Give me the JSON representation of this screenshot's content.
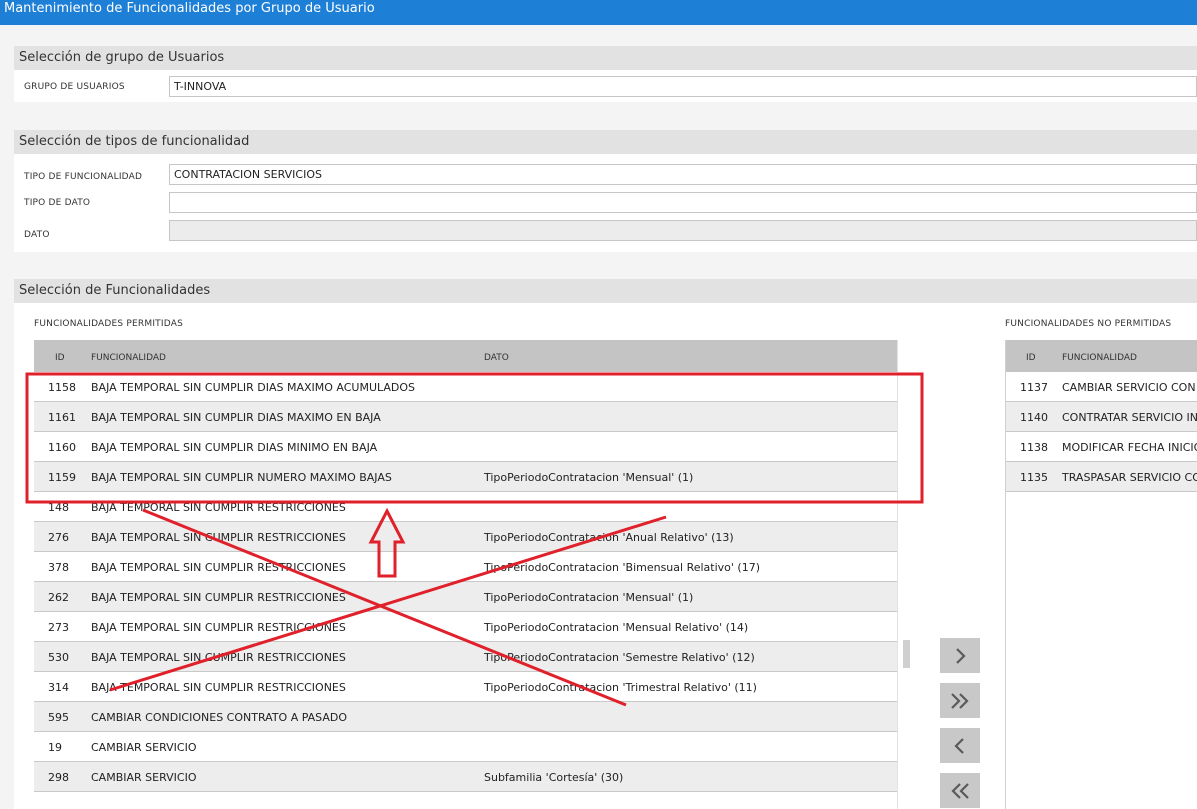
{
  "window": {
    "title": "Mantenimiento de Funcionalidades por Grupo de Usuario"
  },
  "user_group_section": {
    "title": "Selección de grupo de Usuarios",
    "group_label": "GRUPO DE USUARIOS",
    "group_value": "T-INNOVA"
  },
  "type_section": {
    "title": "Selección de tipos de funcionalidad",
    "func_type_label": "TIPO DE FUNCIONALIDAD",
    "func_type_value": "CONTRATACION SERVICIOS",
    "data_type_label": "TIPO DE DATO",
    "data_type_value": "",
    "data_label": "DATO",
    "data_value": ""
  },
  "functions_section": {
    "title": "Selección de Funcionalidades",
    "permitted": {
      "caption": "FUNCIONALIDADES PERMITIDAS",
      "columns": [
        "ID",
        "FUNCIONALIDAD",
        "DATO"
      ],
      "rows": [
        {
          "id": "1158",
          "name": "BAJA TEMPORAL SIN CUMPLIR DIAS MAXIMO ACUMULADOS",
          "dato": ""
        },
        {
          "id": "1161",
          "name": "BAJA TEMPORAL SIN CUMPLIR DIAS MAXIMO EN BAJA",
          "dato": ""
        },
        {
          "id": "1160",
          "name": "BAJA TEMPORAL SIN CUMPLIR DIAS MINIMO EN BAJA",
          "dato": ""
        },
        {
          "id": "1159",
          "name": "BAJA TEMPORAL SIN CUMPLIR NUMERO MAXIMO BAJAS",
          "dato": "TipoPeriodoContratacion 'Mensual' (1)"
        },
        {
          "id": "148",
          "name": "BAJA TEMPORAL SIN CUMPLIR RESTRICCIONES",
          "dato": ""
        },
        {
          "id": "276",
          "name": "BAJA TEMPORAL SIN CUMPLIR RESTRICCIONES",
          "dato": "TipoPeriodoContratacion 'Anual Relativo' (13)"
        },
        {
          "id": "378",
          "name": "BAJA TEMPORAL SIN CUMPLIR RESTRICCIONES",
          "dato": "TipoPeriodoContratacion 'Bimensual Relativo' (17)"
        },
        {
          "id": "262",
          "name": "BAJA TEMPORAL SIN CUMPLIR RESTRICCIONES",
          "dato": "TipoPeriodoContratacion 'Mensual' (1)"
        },
        {
          "id": "273",
          "name": "BAJA TEMPORAL SIN CUMPLIR RESTRICCIONES",
          "dato": "TipoPeriodoContratacion 'Mensual Relativo' (14)"
        },
        {
          "id": "530",
          "name": "BAJA TEMPORAL SIN CUMPLIR RESTRICCIONES",
          "dato": "TipoPeriodoContratacion 'Semestre Relativo' (12)"
        },
        {
          "id": "314",
          "name": "BAJA TEMPORAL SIN CUMPLIR RESTRICCIONES",
          "dato": "TipoPeriodoContratacion 'Trimestral Relativo' (11)"
        },
        {
          "id": "595",
          "name": "CAMBIAR CONDICIONES CONTRATO A PASADO",
          "dato": ""
        },
        {
          "id": "19",
          "name": "CAMBIAR SERVICIO",
          "dato": ""
        },
        {
          "id": "298",
          "name": "CAMBIAR SERVICIO",
          "dato": "Subfamilia 'Cortesía' (30)"
        }
      ]
    },
    "not_permitted": {
      "caption": "FUNCIONALIDADES NO PERMITIDAS",
      "columns": [
        "ID",
        "FUNCIONALIDAD"
      ],
      "rows": [
        {
          "id": "1137",
          "name": "CAMBIAR SERVICIO CON"
        },
        {
          "id": "1140",
          "name": "CONTRATAR SERVICIO IN"
        },
        {
          "id": "1138",
          "name": "MODIFICAR FECHA INICIO"
        },
        {
          "id": "1135",
          "name": "TRASPASAR SERVICIO CO"
        }
      ]
    },
    "move_buttons": [
      {
        "icon": "chevron-right-icon",
        "glyph": "›"
      },
      {
        "icon": "double-chevron-right-icon",
        "glyph": "»"
      },
      {
        "icon": "chevron-left-icon",
        "glyph": "‹"
      },
      {
        "icon": "double-chevron-left-icon",
        "glyph": "«"
      }
    ]
  },
  "annotation": {
    "color": "#e0202a"
  }
}
